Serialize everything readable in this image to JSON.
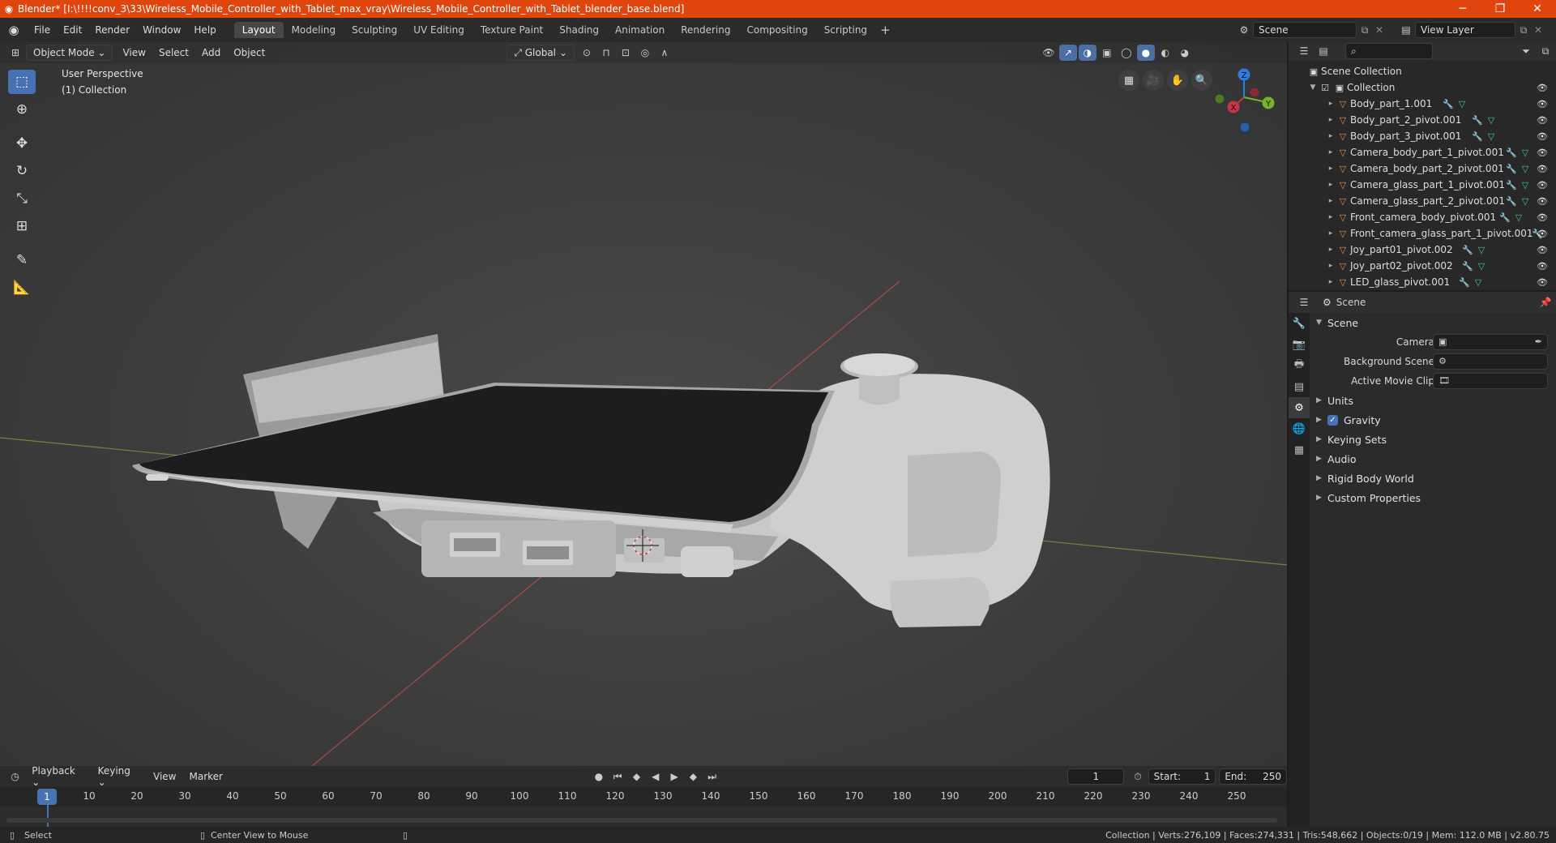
{
  "window": {
    "title": "Blender* [I:\\!!!!conv_3\\33\\Wireless_Mobile_Controller_with_Tablet_max_vray\\Wireless_Mobile_Controller_with_Tablet_blender_base.blend]",
    "minimize": "─",
    "restore": "❐",
    "close": "✕"
  },
  "menu": {
    "items": [
      "File",
      "Edit",
      "Render",
      "Window",
      "Help"
    ],
    "tabs": [
      "Layout",
      "Modeling",
      "Sculpting",
      "UV Editing",
      "Texture Paint",
      "Shading",
      "Animation",
      "Rendering",
      "Compositing",
      "Scripting"
    ],
    "active_tab": "Layout",
    "plus": "+",
    "scene": "Scene",
    "view_layer": "View Layer"
  },
  "viewport": {
    "mode": "Object Mode",
    "menus": [
      "View",
      "Select",
      "Add",
      "Object"
    ],
    "transform": "Global",
    "perspective": "User Perspective",
    "collection": "(1) Collection",
    "axes": {
      "x": "X",
      "y": "Y",
      "z": "Z"
    }
  },
  "outliner": {
    "root": "Scene Collection",
    "collection": "Collection",
    "objects": [
      "Body_part_1.001",
      "Body_part_2_pivot.001",
      "Body_part_3_pivot.001",
      "Camera_body_part_1_pivot.001",
      "Camera_body_part_2_pivot.001",
      "Camera_glass_part_1_pivot.001",
      "Camera_glass_part_2_pivot.001",
      "Front_camera_body_pivot.001",
      "Front_camera_glass_part_1_pivot.001",
      "Joy_part01_pivot.002",
      "Joy_part02_pivot.002",
      "LED_glass_pivot.001"
    ]
  },
  "properties": {
    "header": "Scene",
    "section": "Scene",
    "fields": [
      {
        "label": "Camera"
      },
      {
        "label": "Background Scene"
      },
      {
        "label": "Active Movie Clip"
      }
    ],
    "subsections": [
      "Units",
      "Gravity",
      "Keying Sets",
      "Audio",
      "Rigid Body World",
      "Custom Properties"
    ]
  },
  "timeline": {
    "menus": [
      "Playback",
      "Keying",
      "View",
      "Marker"
    ],
    "current_frame": "1",
    "start_label": "Start:",
    "start": "1",
    "end_label": "End:",
    "end": "250",
    "ruler": [
      "10",
      "20",
      "30",
      "40",
      "50",
      "60",
      "70",
      "80",
      "90",
      "100",
      "110",
      "120",
      "130",
      "140",
      "150",
      "160",
      "170",
      "180",
      "190",
      "200",
      "210",
      "220",
      "230",
      "240",
      "250"
    ]
  },
  "status": {
    "left": "Select",
    "middle": "Center View to Mouse",
    "right": "Collection | Verts:276,109 | Faces:274,331 | Tris:548,662 | Objects:0/19 | Mem: 112.0 MB | v2.80.75"
  },
  "colors": {
    "titlebar": "#e0450e",
    "accent": "#4772b3",
    "axis_x": "#c8334a",
    "axis_y": "#7ab22d",
    "axis_z": "#2d7de0",
    "object_icon": "#e8944a"
  }
}
